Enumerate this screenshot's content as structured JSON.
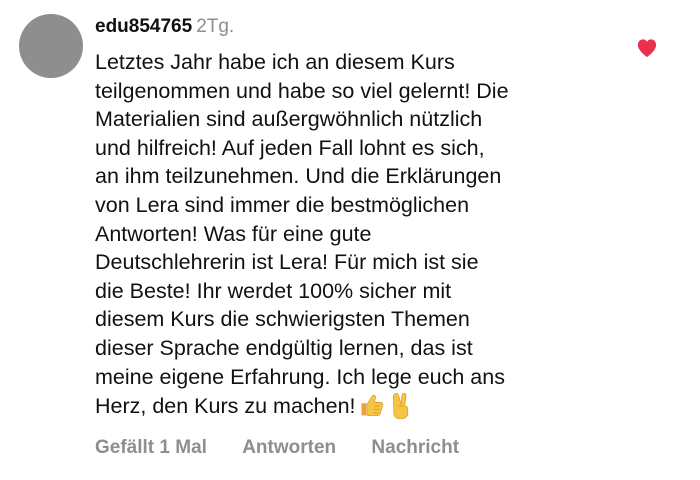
{
  "comment": {
    "username": "edu854765",
    "time": "2Tg.",
    "lines": [
      "Letztes Jahr habe ich an diesem Kurs",
      "teilgenommen und habe so viel gelernt! Die",
      "Materialien sind außergwöhnlich nützlich",
      "und hilfreich! Auf jeden Fall lohnt es sich,",
      "an ihm teilzunehmen. Und die Erklärungen",
      "von Lera sind immer die bestmöglichen",
      "Antworten! Was für eine gute",
      "Deutschlehrerin ist Lera! Für mich ist sie",
      "die Beste! Ihr werdet 100% sicher mit",
      "diesem Kurs die schwierigsten Themen",
      "dieser Sprache endgültig lernen, das ist",
      "meine eigene Erfahrung. Ich lege euch ans",
      "Herz, den Kurs zu machen!"
    ],
    "emojis": [
      "thumbs-up-icon",
      "victory-hand-icon"
    ],
    "actions": {
      "likes": "Gefällt 1 Mal",
      "reply": "Antworten",
      "message": "Nachricht"
    },
    "liked": true,
    "colors": {
      "heart": "#ed2e4d",
      "muted": "#8e8e8e",
      "avatar": "#8e8e8e",
      "text": "#111111"
    }
  }
}
